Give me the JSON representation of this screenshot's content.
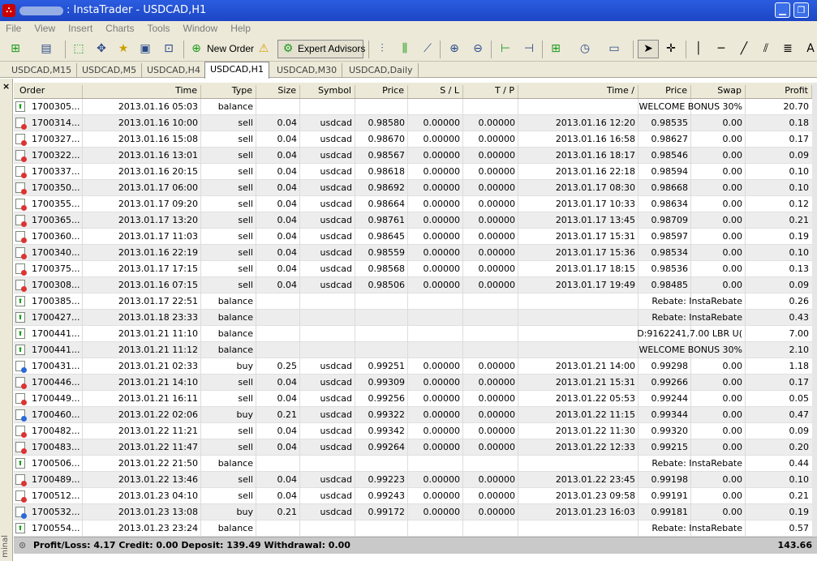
{
  "window": {
    "title": ": InstaTrader - USDCAD,H1"
  },
  "menu": [
    "File",
    "View",
    "Insert",
    "Charts",
    "Tools",
    "Window",
    "Help"
  ],
  "toolbar": {
    "new_order": "New Order",
    "expert_advisors": "Expert Advisors"
  },
  "tabs": [
    "USDCAD,M15",
    "USDCAD,M5",
    "USDCAD,H4",
    "USDCAD,H1",
    "USDCAD,M30",
    "USDCAD,Daily"
  ],
  "active_tab": "USDCAD,H1",
  "columns": {
    "order": "Order",
    "time": "Time",
    "type": "Type",
    "size": "Size",
    "symbol": "Symbol",
    "price": "Price",
    "sl": "S / L",
    "tp": "T / P",
    "close_time": "Time  /",
    "close_price": "Price",
    "swap": "Swap",
    "profit": "Profit"
  },
  "rows": [
    {
      "kind": "balance",
      "order": "1700305...",
      "time": "2013.01.16 05:03",
      "type": "balance",
      "comment": "WELCOME BONUS 30%",
      "profit": "20.70"
    },
    {
      "kind": "sell",
      "order": "1700314...",
      "time": "2013.01.16 10:00",
      "type": "sell",
      "size": "0.04",
      "symbol": "usdcad",
      "price": "0.98580",
      "sl": "0.00000",
      "tp": "0.00000",
      "close_time": "2013.01.16 12:20",
      "close_price": "0.98535",
      "swap": "0.00",
      "profit": "0.18"
    },
    {
      "kind": "sell",
      "order": "1700327...",
      "time": "2013.01.16 15:08",
      "type": "sell",
      "size": "0.04",
      "symbol": "usdcad",
      "price": "0.98670",
      "sl": "0.00000",
      "tp": "0.00000",
      "close_time": "2013.01.16 16:58",
      "close_price": "0.98627",
      "swap": "0.00",
      "profit": "0.17"
    },
    {
      "kind": "sell",
      "order": "1700322...",
      "time": "2013.01.16 13:01",
      "type": "sell",
      "size": "0.04",
      "symbol": "usdcad",
      "price": "0.98567",
      "sl": "0.00000",
      "tp": "0.00000",
      "close_time": "2013.01.16 18:17",
      "close_price": "0.98546",
      "swap": "0.00",
      "profit": "0.09"
    },
    {
      "kind": "sell",
      "order": "1700337...",
      "time": "2013.01.16 20:15",
      "type": "sell",
      "size": "0.04",
      "symbol": "usdcad",
      "price": "0.98618",
      "sl": "0.00000",
      "tp": "0.00000",
      "close_time": "2013.01.16 22:18",
      "close_price": "0.98594",
      "swap": "0.00",
      "profit": "0.10"
    },
    {
      "kind": "sell",
      "order": "1700350...",
      "time": "2013.01.17 06:00",
      "type": "sell",
      "size": "0.04",
      "symbol": "usdcad",
      "price": "0.98692",
      "sl": "0.00000",
      "tp": "0.00000",
      "close_time": "2013.01.17 08:30",
      "close_price": "0.98668",
      "swap": "0.00",
      "profit": "0.10"
    },
    {
      "kind": "sell",
      "order": "1700355...",
      "time": "2013.01.17 09:20",
      "type": "sell",
      "size": "0.04",
      "symbol": "usdcad",
      "price": "0.98664",
      "sl": "0.00000",
      "tp": "0.00000",
      "close_time": "2013.01.17 10:33",
      "close_price": "0.98634",
      "swap": "0.00",
      "profit": "0.12"
    },
    {
      "kind": "sell",
      "order": "1700365...",
      "time": "2013.01.17 13:20",
      "type": "sell",
      "size": "0.04",
      "symbol": "usdcad",
      "price": "0.98761",
      "sl": "0.00000",
      "tp": "0.00000",
      "close_time": "2013.01.17 13:45",
      "close_price": "0.98709",
      "swap": "0.00",
      "profit": "0.21"
    },
    {
      "kind": "sell",
      "order": "1700360...",
      "time": "2013.01.17 11:03",
      "type": "sell",
      "size": "0.04",
      "symbol": "usdcad",
      "price": "0.98645",
      "sl": "0.00000",
      "tp": "0.00000",
      "close_time": "2013.01.17 15:31",
      "close_price": "0.98597",
      "swap": "0.00",
      "profit": "0.19"
    },
    {
      "kind": "sell",
      "order": "1700340...",
      "time": "2013.01.16 22:19",
      "type": "sell",
      "size": "0.04",
      "symbol": "usdcad",
      "price": "0.98559",
      "sl": "0.00000",
      "tp": "0.00000",
      "close_time": "2013.01.17 15:36",
      "close_price": "0.98534",
      "swap": "0.00",
      "profit": "0.10"
    },
    {
      "kind": "sell",
      "order": "1700375...",
      "time": "2013.01.17 17:15",
      "type": "sell",
      "size": "0.04",
      "symbol": "usdcad",
      "price": "0.98568",
      "sl": "0.00000",
      "tp": "0.00000",
      "close_time": "2013.01.17 18:15",
      "close_price": "0.98536",
      "swap": "0.00",
      "profit": "0.13"
    },
    {
      "kind": "sell",
      "order": "1700308...",
      "time": "2013.01.16 07:15",
      "type": "sell",
      "size": "0.04",
      "symbol": "usdcad",
      "price": "0.98506",
      "sl": "0.00000",
      "tp": "0.00000",
      "close_time": "2013.01.17 19:49",
      "close_price": "0.98485",
      "swap": "0.00",
      "profit": "0.09"
    },
    {
      "kind": "balance",
      "order": "1700385...",
      "time": "2013.01.17 22:51",
      "type": "balance",
      "comment": "Rebate: InstaRebate",
      "profit": "0.26"
    },
    {
      "kind": "balance",
      "order": "1700427...",
      "time": "2013.01.18 23:33",
      "type": "balance",
      "comment": "Rebate: InstaRebate",
      "profit": "0.43"
    },
    {
      "kind": "balance",
      "order": "1700441...",
      "time": "2013.01.21 11:10",
      "type": "balance",
      "comment": "D:9162241,7.00 LBR U(",
      "profit": "7.00"
    },
    {
      "kind": "balance",
      "order": "1700441...",
      "time": "2013.01.21 11:12",
      "type": "balance",
      "comment": "WELCOME BONUS 30%",
      "profit": "2.10"
    },
    {
      "kind": "buy",
      "order": "1700431...",
      "time": "2013.01.21 02:33",
      "type": "buy",
      "size": "0.25",
      "symbol": "usdcad",
      "price": "0.99251",
      "sl": "0.00000",
      "tp": "0.00000",
      "close_time": "2013.01.21 14:00",
      "close_price": "0.99298",
      "swap": "0.00",
      "profit": "1.18"
    },
    {
      "kind": "sell",
      "order": "1700446...",
      "time": "2013.01.21 14:10",
      "type": "sell",
      "size": "0.04",
      "symbol": "usdcad",
      "price": "0.99309",
      "sl": "0.00000",
      "tp": "0.00000",
      "close_time": "2013.01.21 15:31",
      "close_price": "0.99266",
      "swap": "0.00",
      "profit": "0.17"
    },
    {
      "kind": "sell",
      "order": "1700449...",
      "time": "2013.01.21 16:11",
      "type": "sell",
      "size": "0.04",
      "symbol": "usdcad",
      "price": "0.99256",
      "sl": "0.00000",
      "tp": "0.00000",
      "close_time": "2013.01.22 05:53",
      "close_price": "0.99244",
      "swap": "0.00",
      "profit": "0.05"
    },
    {
      "kind": "buy",
      "order": "1700460...",
      "time": "2013.01.22 02:06",
      "type": "buy",
      "size": "0.21",
      "symbol": "usdcad",
      "price": "0.99322",
      "sl": "0.00000",
      "tp": "0.00000",
      "close_time": "2013.01.22 11:15",
      "close_price": "0.99344",
      "swap": "0.00",
      "profit": "0.47"
    },
    {
      "kind": "sell",
      "order": "1700482...",
      "time": "2013.01.22 11:21",
      "type": "sell",
      "size": "0.04",
      "symbol": "usdcad",
      "price": "0.99342",
      "sl": "0.00000",
      "tp": "0.00000",
      "close_time": "2013.01.22 11:30",
      "close_price": "0.99320",
      "swap": "0.00",
      "profit": "0.09"
    },
    {
      "kind": "sell",
      "order": "1700483...",
      "time": "2013.01.22 11:47",
      "type": "sell",
      "size": "0.04",
      "symbol": "usdcad",
      "price": "0.99264",
      "sl": "0.00000",
      "tp": "0.00000",
      "close_time": "2013.01.22 12:33",
      "close_price": "0.99215",
      "swap": "0.00",
      "profit": "0.20"
    },
    {
      "kind": "balance",
      "order": "1700506...",
      "time": "2013.01.22 21:50",
      "type": "balance",
      "comment": "Rebate: InstaRebate",
      "profit": "0.44"
    },
    {
      "kind": "sell",
      "order": "1700489...",
      "time": "2013.01.22 13:46",
      "type": "sell",
      "size": "0.04",
      "symbol": "usdcad",
      "price": "0.99223",
      "sl": "0.00000",
      "tp": "0.00000",
      "close_time": "2013.01.22 23:45",
      "close_price": "0.99198",
      "swap": "0.00",
      "profit": "0.10"
    },
    {
      "kind": "sell",
      "order": "1700512...",
      "time": "2013.01.23 04:10",
      "type": "sell",
      "size": "0.04",
      "symbol": "usdcad",
      "price": "0.99243",
      "sl": "0.00000",
      "tp": "0.00000",
      "close_time": "2013.01.23 09:58",
      "close_price": "0.99191",
      "swap": "0.00",
      "profit": "0.21"
    },
    {
      "kind": "buy",
      "order": "1700532...",
      "time": "2013.01.23 13:08",
      "type": "buy",
      "size": "0.21",
      "symbol": "usdcad",
      "price": "0.99172",
      "sl": "0.00000",
      "tp": "0.00000",
      "close_time": "2013.01.23 16:03",
      "close_price": "0.99181",
      "swap": "0.00",
      "profit": "0.19"
    },
    {
      "kind": "balance",
      "order": "1700554...",
      "time": "2013.01.23 23:24",
      "type": "balance",
      "comment": "Rebate: InstaRebate",
      "profit": "0.57"
    }
  ],
  "footer": {
    "summary": "Profit/Loss: 4.17  Credit: 0.00  Deposit: 139.49  Withdrawal: 0.00",
    "total": "143.66"
  },
  "side_label": "minal",
  "colors": {
    "titlebar": "#1c46c4",
    "sell_icon": "#d33",
    "buy_icon": "#2a6ad8",
    "balance_icon": "#090"
  }
}
